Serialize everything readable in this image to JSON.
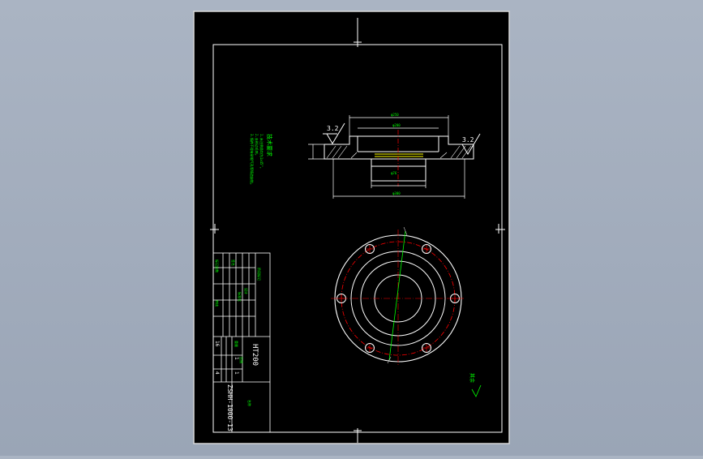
{
  "drawing": {
    "material": "HT200",
    "drawing_number": "ZSHH-1000-13",
    "roughness_value": "3.2",
    "title_block_small": {
      "scale_label": "比例",
      "quantity": "1",
      "sheet_number": "4",
      "sheets": "16",
      "part_count": "1"
    }
  },
  "colors": {
    "background": "#000000",
    "frame": "#ffffff",
    "text": "#00ff00",
    "centerline": "#ff0000",
    "hidden": "#ffff00"
  }
}
